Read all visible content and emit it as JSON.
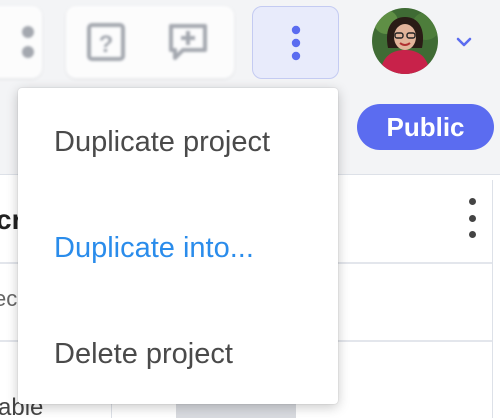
{
  "toolbar": {
    "buttons": [
      {
        "name": "grid",
        "icon": "grid-icon"
      },
      {
        "name": "help",
        "icon": "help-icon"
      },
      {
        "name": "comment",
        "icon": "add-comment-icon"
      },
      {
        "name": "more",
        "icon": "kebab-vertical-icon"
      }
    ],
    "more_color": "#5b6cf0",
    "account_chevron_color": "#5b6cf0"
  },
  "badge": {
    "label": "Public",
    "color": "#5b6cf0"
  },
  "background": {
    "cells": [
      "cr",
      "ec",
      "able"
    ]
  },
  "menu": {
    "items": [
      {
        "label": "Duplicate project",
        "active": false
      },
      {
        "label": "Duplicate into...",
        "active": true
      },
      {
        "label": "Delete project",
        "active": false
      }
    ],
    "active_color": "#2a8ceb"
  }
}
